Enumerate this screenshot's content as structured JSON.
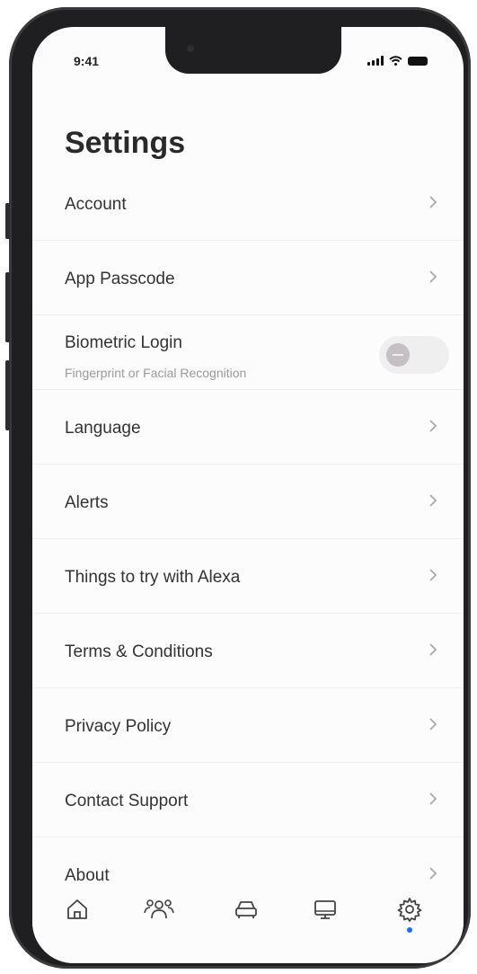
{
  "status_bar": {
    "time": "9:41"
  },
  "header": {
    "title": "Settings"
  },
  "settings": {
    "items": [
      {
        "label": "Account"
      },
      {
        "label": "App Passcode"
      },
      {
        "label": "Biometric Login",
        "sublabel": "Fingerprint or Facial Recognition",
        "toggle_on": false
      },
      {
        "label": "Language"
      },
      {
        "label": "Alerts"
      },
      {
        "label": "Things to try with Alexa"
      },
      {
        "label": "Terms & Conditions"
      },
      {
        "label": "Privacy Policy"
      },
      {
        "label": "Contact Support"
      },
      {
        "label": "About"
      }
    ]
  },
  "bottom_nav": {
    "items": [
      {
        "icon": "home-icon"
      },
      {
        "icon": "people-icon"
      },
      {
        "icon": "car-icon"
      },
      {
        "icon": "monitor-icon"
      },
      {
        "icon": "gear-icon",
        "active": true
      }
    ]
  },
  "colors": {
    "active_dot": "#1a6ff0",
    "text": "#333333",
    "subtext": "#9a9a9a"
  }
}
